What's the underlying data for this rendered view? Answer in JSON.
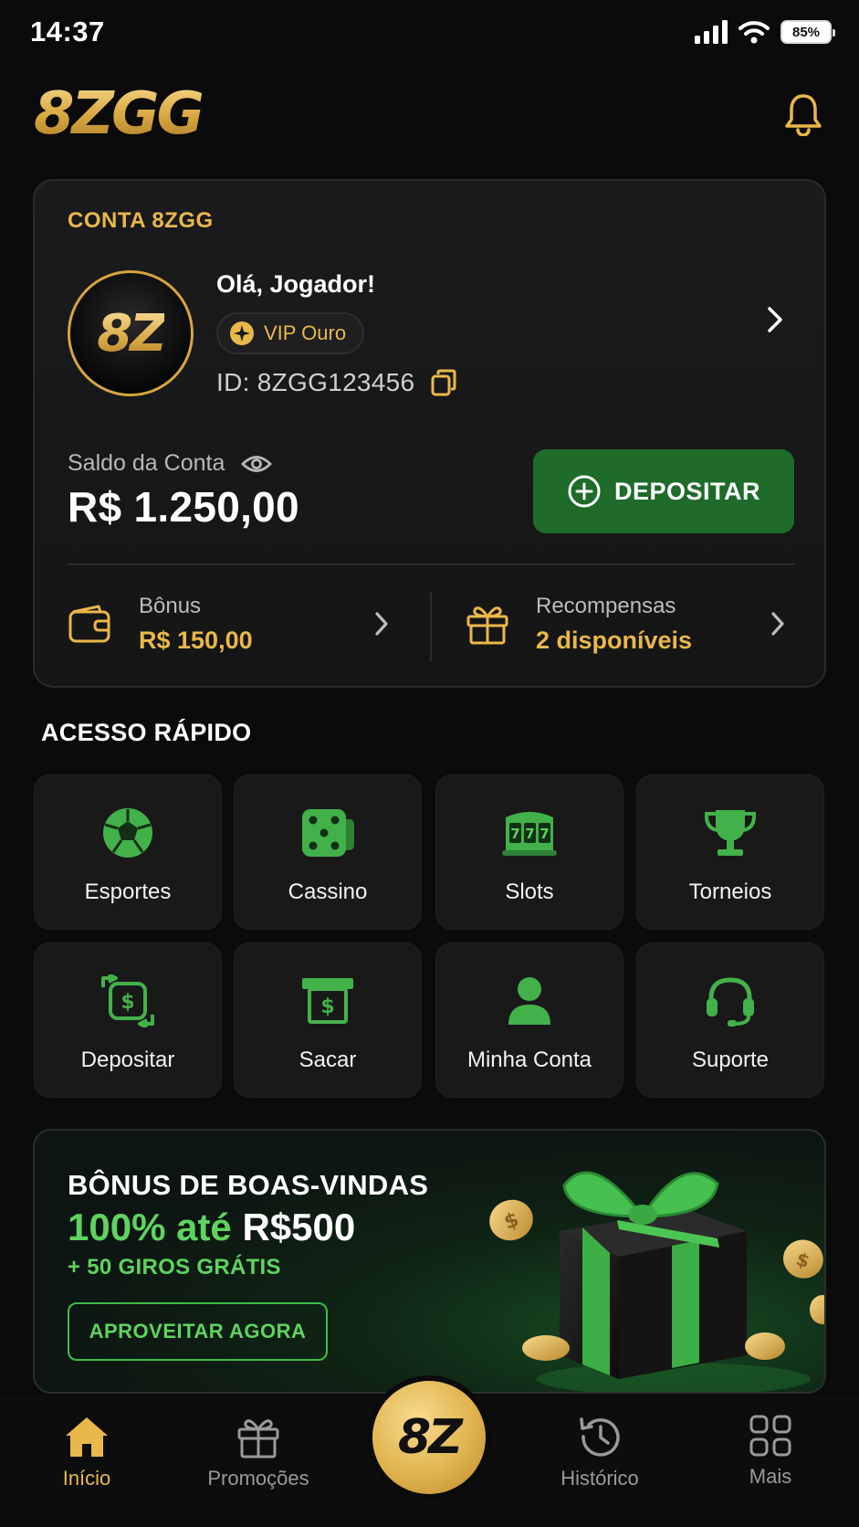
{
  "status_bar": {
    "time": "14:37",
    "battery": "85%"
  },
  "header": {
    "logo": "8ZGG",
    "notification_icon": "bell-icon"
  },
  "account": {
    "label": "CONTA 8ZGG",
    "avatar_text": "8Z",
    "greeting": "Olá, Jogador!",
    "vip": "VIP Ouro",
    "user_id": "ID: 8ZGG123456",
    "balance_label": "Saldo da Conta",
    "balance": "R$ 1.250,00",
    "deposit_button": "DEPOSITAR",
    "bonus": {
      "title": "Bônus",
      "value": "R$ 150,00"
    },
    "rewards": {
      "title": "Recompensas",
      "value": "2 disponíveis"
    }
  },
  "quick_access": {
    "title": "ACESSO RÁPIDO",
    "items": [
      {
        "label": "Esportes",
        "icon": "soccer-ball-icon"
      },
      {
        "label": "Cassino",
        "icon": "dice-icon"
      },
      {
        "label": "Slots",
        "icon": "slot-machine-icon"
      },
      {
        "label": "Torneios",
        "icon": "trophy-icon"
      },
      {
        "label": "Depositar",
        "icon": "deposit-exchange-icon"
      },
      {
        "label": "Sacar",
        "icon": "atm-withdraw-icon"
      },
      {
        "label": "Minha Conta",
        "icon": "user-icon"
      },
      {
        "label": "Suporte",
        "icon": "headset-icon"
      }
    ]
  },
  "promo": {
    "title": "BÔNUS DE BOAS-VINDAS",
    "amount_green": "100% até",
    "amount_white": "R$500",
    "spins": "+ 50 GIROS GRÁTIS",
    "button": "APROVEITAR AGORA"
  },
  "bottom_nav": {
    "items": [
      {
        "label": "Início",
        "icon": "home-icon",
        "active": true
      },
      {
        "label": "Promoções",
        "icon": "gift-icon",
        "active": false
      },
      {
        "label": "Histórico",
        "icon": "history-icon",
        "active": false
      },
      {
        "label": "Mais",
        "icon": "grid-icon",
        "active": false
      }
    ],
    "center_label": "8Z"
  },
  "colors": {
    "gold": "#e9b84a",
    "green": "#1f6b2a",
    "accent_green": "#5fd35f",
    "background": "#0b0b0c"
  }
}
